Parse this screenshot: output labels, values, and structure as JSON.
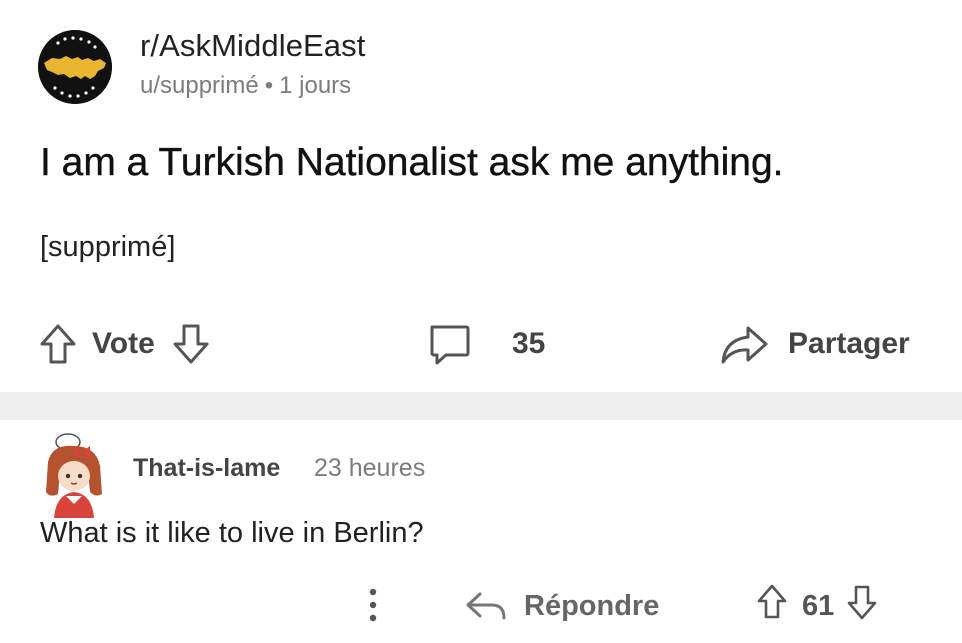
{
  "post": {
    "subreddit": "r/AskMiddleEast",
    "author": "u/supprimé",
    "separator": "•",
    "age": "1 jours",
    "title": "I am a Turkish Nationalist ask me anything.",
    "body": "[supprimé]",
    "actions": {
      "vote_label": "Vote",
      "comment_count": "35",
      "share_label": "Partager"
    }
  },
  "comment": {
    "author": "That-is-lame",
    "age": "23 heures",
    "text": "What is it like to live in Berlin?",
    "reply_label": "Répondre",
    "score": "61"
  },
  "icons": {
    "avatar": "arab-world-map-avatar",
    "upvote": "arrow-up-icon",
    "downvote": "arrow-down-icon",
    "comments": "speech-bubble-icon",
    "share": "share-arrow-icon",
    "more": "vertical-dots-icon",
    "reply": "reply-arrow-icon"
  },
  "colors": {
    "text_primary": "#111111",
    "text_secondary": "#7c7c7c",
    "separator": "#eeeeee",
    "avatar_bg": "#111111",
    "avatar_map": "#e8b72f"
  }
}
